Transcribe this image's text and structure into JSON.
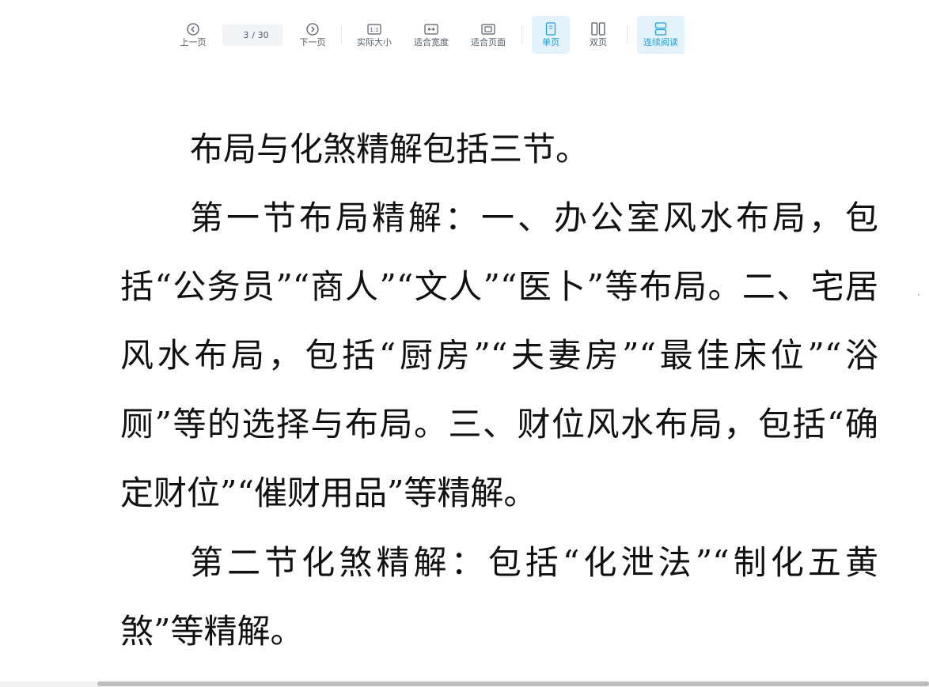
{
  "toolbar": {
    "prev_label": "上一页",
    "page_current": "3",
    "page_total": "/ 30",
    "next_label": "下一页",
    "actual_size_label": "实际大小",
    "actual_size_icon_text": "1:1",
    "fit_width_label": "适合宽度",
    "fit_page_label": "适合页面",
    "single_page_label": "单页",
    "double_page_label": "双页",
    "continuous_label": "连续阅读",
    "active_color": "#1a9fe0",
    "active_bg": "#e4f3fb"
  },
  "document": {
    "paragraphs": [
      "布局与化煞精解包括三节。",
      "第一节布局精解：一、办公室风水布局，包括“公务员”“商人”“文人”“医卜”等布局。二、宅居风水布局，包括“厨房”“夫妻房”“最佳床位”“浴厕”等的选择与布局。三、财位风水布局，包括“确定财位”“催财用品”等精解。",
      "第二节化煞精解：包括“化泄法”“制化五黄煞”等精解。"
    ]
  },
  "icons": {
    "prev": "chevron-left-circle-icon",
    "next": "chevron-right-circle-icon",
    "actual_size": "actual-size-icon",
    "fit_width": "fit-width-icon",
    "fit_page": "fit-page-icon",
    "single_page": "single-page-icon",
    "double_page": "double-page-icon",
    "continuous": "continuous-read-icon"
  }
}
